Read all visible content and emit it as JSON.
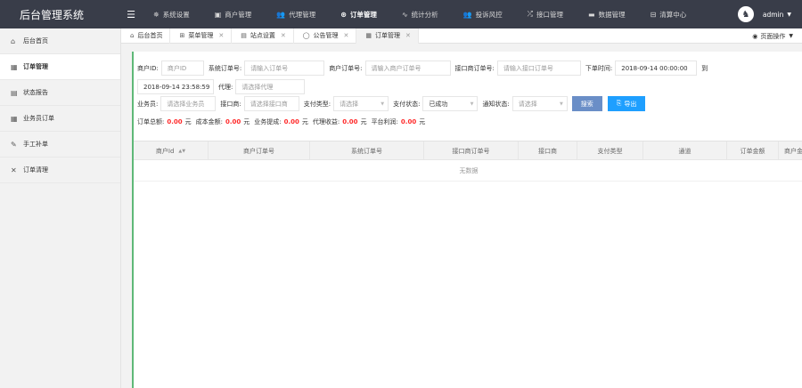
{
  "app": {
    "brand": "后台管理系统",
    "menu_icon": "hamburger-icon"
  },
  "topnav": [
    {
      "label": "系统设置",
      "icon": "gear-icon",
      "glyph": "✵"
    },
    {
      "label": "商户管理",
      "icon": "merchant-icon",
      "glyph": "▣"
    },
    {
      "label": "代理管理",
      "icon": "users-icon",
      "glyph": "👥"
    },
    {
      "label": "订单管理",
      "icon": "order-icon",
      "glyph": "⊛"
    },
    {
      "label": "统计分析",
      "icon": "chart-icon",
      "glyph": "∿"
    },
    {
      "label": "投诉风控",
      "icon": "shield-users-icon",
      "glyph": "👥"
    },
    {
      "label": "接口管理",
      "icon": "shuffle-icon",
      "glyph": "⤮"
    },
    {
      "label": "数据管理",
      "icon": "data-icon",
      "glyph": "▬"
    },
    {
      "label": "清算中心",
      "icon": "clear-icon",
      "glyph": "⊟"
    }
  ],
  "user": {
    "name": "admin",
    "avatar_glyph": "♞"
  },
  "sidebar": [
    {
      "label": "后台首页",
      "icon": "home-icon",
      "glyph": "⌂"
    },
    {
      "label": "订单管理",
      "icon": "table-icon",
      "glyph": "▦"
    },
    {
      "label": "状态报告",
      "icon": "calendar-icon",
      "glyph": "▤"
    },
    {
      "label": "业务员订单",
      "icon": "table-icon",
      "glyph": "▦"
    },
    {
      "label": "手工补单",
      "icon": "edit-icon",
      "glyph": "✎"
    },
    {
      "label": "订单清理",
      "icon": "close-icon",
      "glyph": "✕"
    }
  ],
  "tabs": [
    {
      "label": "后台首页",
      "icon": "home-icon",
      "glyph": "⌂",
      "closable": false
    },
    {
      "label": "菜单管理",
      "icon": "book-icon",
      "glyph": "⊞",
      "closable": true
    },
    {
      "label": "站点设置",
      "icon": "calendar-icon",
      "glyph": "▤",
      "closable": true
    },
    {
      "label": "公告管理",
      "icon": "circle-icon",
      "glyph": "◯",
      "closable": true
    },
    {
      "label": "订单管理",
      "icon": "table-icon",
      "glyph": "▦",
      "closable": true
    }
  ],
  "page_ops": {
    "label": "页面操作",
    "icon": "target-icon"
  },
  "filters": {
    "merchant_id": {
      "label": "商户ID:",
      "placeholder": "商户ID"
    },
    "sys_order": {
      "label": "系统订单号:",
      "placeholder": "请输入订单号"
    },
    "merchant_order": {
      "label": "商户订单号:",
      "placeholder": "请输入商户订单号"
    },
    "api_order": {
      "label": "接口商订单号:",
      "placeholder": "请输入接口订单号"
    },
    "order_time": {
      "label": "下单时间:",
      "start": "2018-09-14 00:00:00",
      "sep": "到",
      "end": "2018-09-14 23:58:59"
    },
    "agent": {
      "label": "代理:",
      "placeholder": "请选择代理"
    },
    "salesman": {
      "label": "业务员:",
      "placeholder": "请选择业务员"
    },
    "api_vendor": {
      "label": "接口商:",
      "placeholder": "请选择接口商"
    },
    "pay_type": {
      "label": "支付类型:",
      "placeholder": "请选择"
    },
    "pay_status": {
      "label": "支付状态:",
      "value": "已成功"
    },
    "notify_status": {
      "label": "通知状态:",
      "placeholder": "请选择"
    },
    "search_button": "搜索",
    "export_button": "导出"
  },
  "summary": [
    {
      "label": "订单总额:",
      "amount": "0.00",
      "unit": "元"
    },
    {
      "label": "成本金额:",
      "amount": "0.00",
      "unit": "元"
    },
    {
      "label": "业务提成:",
      "amount": "0.00",
      "unit": "元"
    },
    {
      "label": "代理收益:",
      "amount": "0.00",
      "unit": "元"
    },
    {
      "label": "平台利润:",
      "amount": "0.00",
      "unit": "元"
    }
  ],
  "table": {
    "columns": [
      "商户Id",
      "商户订单号",
      "系统订单号",
      "接口商订单号",
      "接口商",
      "支付类型",
      "通道",
      "订单金额",
      "商户金"
    ],
    "sortable_first": true,
    "empty_text": "无数据"
  },
  "colors": {
    "topbar": "#393d49",
    "accent": "#5fb878",
    "amount": "#ff2a2a",
    "search": "#6a8ec7",
    "export": "#1e9fff"
  }
}
